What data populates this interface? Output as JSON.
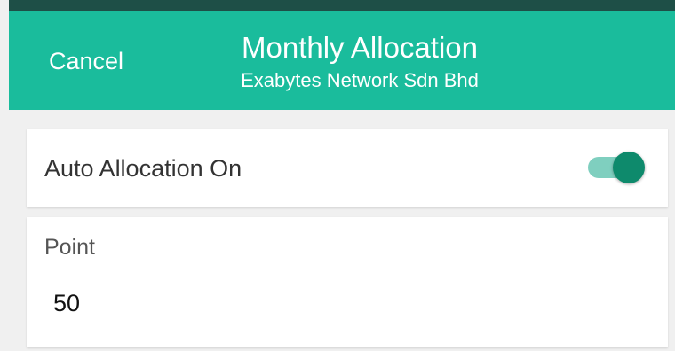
{
  "header": {
    "cancel_label": "Cancel",
    "title": "Monthly Allocation",
    "subtitle": "Exabytes Network Sdn Bhd",
    "background_color": "#1abc9c"
  },
  "auto_allocation": {
    "label": "Auto Allocation On",
    "enabled": true,
    "toggle_color": "#0e8a6c"
  },
  "point": {
    "label": "Point",
    "value": "50"
  }
}
